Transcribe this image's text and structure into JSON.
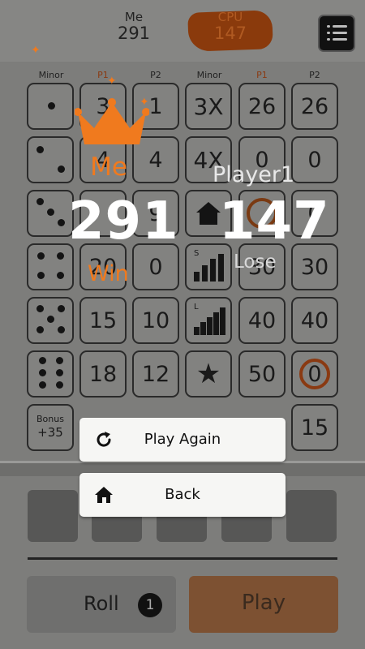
{
  "header": {
    "me": {
      "name": "Me",
      "score": "291"
    },
    "cpu": {
      "name": "CPU",
      "score": "147"
    },
    "menu_icon": "menu-list-icon"
  },
  "board": {
    "columns_left": [
      "Minor",
      "P1",
      "P2"
    ],
    "columns_right": [
      "Minor",
      "P1",
      "P2"
    ],
    "left_rows": [
      {
        "category": "dice-1",
        "p1": "3",
        "p2": "1"
      },
      {
        "category": "dice-2",
        "p1": "4",
        "p2": "4"
      },
      {
        "category": "dice-3",
        "p1": "",
        "p2": "9"
      },
      {
        "category": "dice-4",
        "p1": "20",
        "p2": "0"
      },
      {
        "category": "dice-5",
        "p1": "15",
        "p2": "10"
      },
      {
        "category": "dice-6",
        "p1": "18",
        "p2": "12"
      }
    ],
    "bonus": {
      "label": "Bonus",
      "value": "+35"
    },
    "right_rows": [
      {
        "category": "3X",
        "p1": "26",
        "p2": "26"
      },
      {
        "category": "4X",
        "p1": "0",
        "p2": "0"
      },
      {
        "category": "full-house-icon",
        "p1": "",
        "p2": "0"
      },
      {
        "category": "small-straight-icon",
        "p1": "30",
        "p2": "30"
      },
      {
        "category": "large-straight-icon",
        "p1": "40",
        "p2": "40"
      },
      {
        "category": "star-icon",
        "p1": "50",
        "p2": "0"
      }
    ],
    "right_last_value": "15",
    "small_straight_letter": "S",
    "large_straight_letter": "L"
  },
  "result": {
    "me_label": "Me",
    "me_score": "291",
    "me_status": "Win",
    "cpu_label": "Player1",
    "cpu_score": "147",
    "cpu_status": "Lose"
  },
  "dialog": {
    "play_again": "Play Again",
    "back": "Back"
  },
  "controls": {
    "roll_label": "Roll",
    "roll_count": "1",
    "play_label": "Play"
  },
  "colors": {
    "accent": "#f07a1e",
    "cpu_brush": "#8a3a0c"
  }
}
